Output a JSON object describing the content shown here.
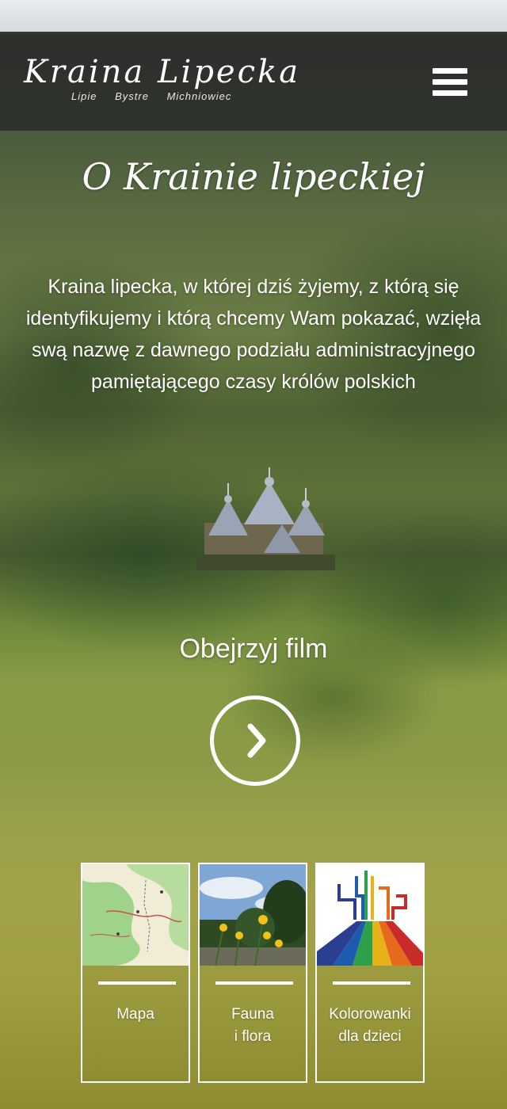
{
  "header": {
    "logo_title": "Kraina Lipecka",
    "logo_places": [
      "Lipie",
      "Bystre",
      "Michniowiec"
    ],
    "menu_icon": "hamburger-icon"
  },
  "main": {
    "title": "O Krainie lipeckiej",
    "intro": "Kraina lipecka, w której dziś żyjemy, z którą się identyfikujemy i którą chcemy Wam pokazać, wzięła swą nazwę z dawnego podziału administracyjnego pamiętającego czasy królów polskich",
    "film_label": "Obejrzyj film",
    "play_icon": "play-arrow-icon"
  },
  "tiles": [
    {
      "label": "Mapa"
    },
    {
      "label": "Fauna\ni flora"
    },
    {
      "label": "Kolorowanki\ndla dzieci"
    }
  ],
  "colors": {
    "header_bg": "#2a2a2a",
    "text": "#ffffff"
  }
}
